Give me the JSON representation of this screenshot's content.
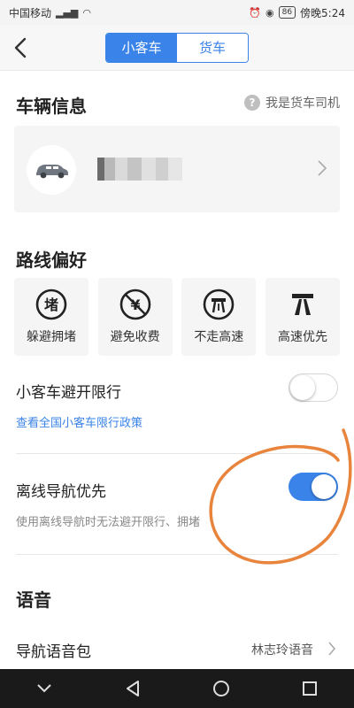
{
  "status_bar": {
    "carrier": "中国移动",
    "battery": "86",
    "time": "傍晚5:24"
  },
  "segments": [
    {
      "label": "小客车",
      "active": true
    },
    {
      "label": "货车",
      "active": false
    }
  ],
  "vehicle_section": {
    "title": "车辆信息",
    "driver_link": "我是货车司机"
  },
  "route_section": {
    "title": "路线偏好",
    "options": [
      {
        "label": "躲避拥堵",
        "icon": "avoid-congestion-icon"
      },
      {
        "label": "避免收费",
        "icon": "avoid-toll-icon"
      },
      {
        "label": "不走高速",
        "icon": "no-highway-icon"
      },
      {
        "label": "高速优先",
        "icon": "highway-first-icon"
      }
    ]
  },
  "restriction": {
    "label": "小客车避开限行",
    "enabled": false,
    "link": "查看全国小客车限行政策"
  },
  "offline": {
    "label": "离线导航优先",
    "enabled": true,
    "hint": "使用离线导航时无法避开限行、拥堵"
  },
  "voice_section": {
    "title": "语音",
    "row_label": "导航语音包",
    "value": "林志玲语音"
  },
  "colors": {
    "accent": "#3a83e8",
    "annotation": "#e8843c"
  }
}
